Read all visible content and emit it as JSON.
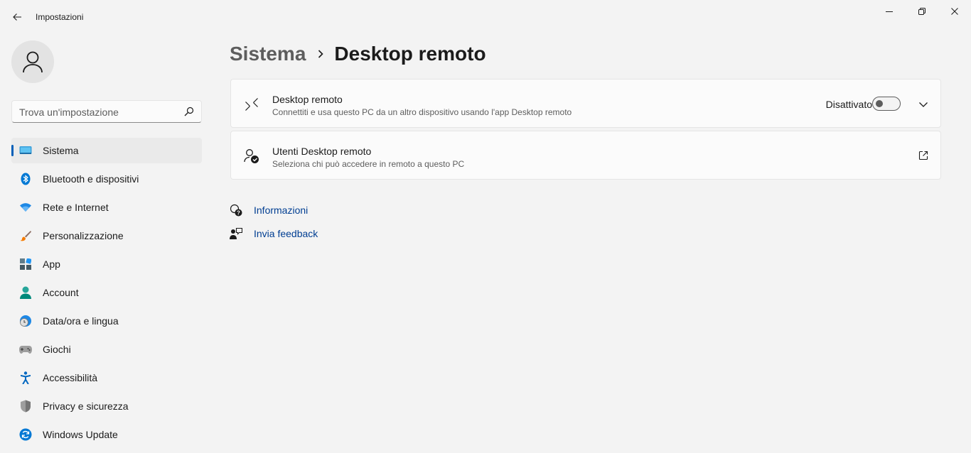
{
  "app": {
    "title": "Impostazioni"
  },
  "search": {
    "placeholder": "Trova un'impostazione"
  },
  "sidebar": {
    "items": [
      {
        "label": "Sistema",
        "icon": "system-icon",
        "active": true
      },
      {
        "label": "Bluetooth e dispositivi",
        "icon": "bluetooth-icon"
      },
      {
        "label": "Rete e Internet",
        "icon": "wifi-icon"
      },
      {
        "label": "Personalizzazione",
        "icon": "brush-icon"
      },
      {
        "label": "App",
        "icon": "apps-icon"
      },
      {
        "label": "Account",
        "icon": "account-icon"
      },
      {
        "label": "Data/ora e lingua",
        "icon": "clock-globe-icon"
      },
      {
        "label": "Giochi",
        "icon": "gamepad-icon"
      },
      {
        "label": "Accessibilità",
        "icon": "accessibility-icon"
      },
      {
        "label": "Privacy e sicurezza",
        "icon": "shield-icon"
      },
      {
        "label": "Windows Update",
        "icon": "update-icon"
      }
    ]
  },
  "breadcrumb": {
    "parent": "Sistema",
    "current": "Desktop remoto"
  },
  "cards": {
    "remote_desktop": {
      "title": "Desktop remoto",
      "description": "Connettiti e usa questo PC da un altro dispositivo usando l'app Desktop remoto",
      "toggle_label": "Disattivato",
      "toggle_on": false
    },
    "remote_users": {
      "title": "Utenti Desktop remoto",
      "description": "Seleziona chi può accedere in remoto a questo PC"
    }
  },
  "help": {
    "info": "Informazioni",
    "feedback": "Invia feedback"
  },
  "colors": {
    "accent": "#005fb8",
    "link": "#003e92",
    "background": "#f3f3f3",
    "card": "#fbfbfb"
  }
}
